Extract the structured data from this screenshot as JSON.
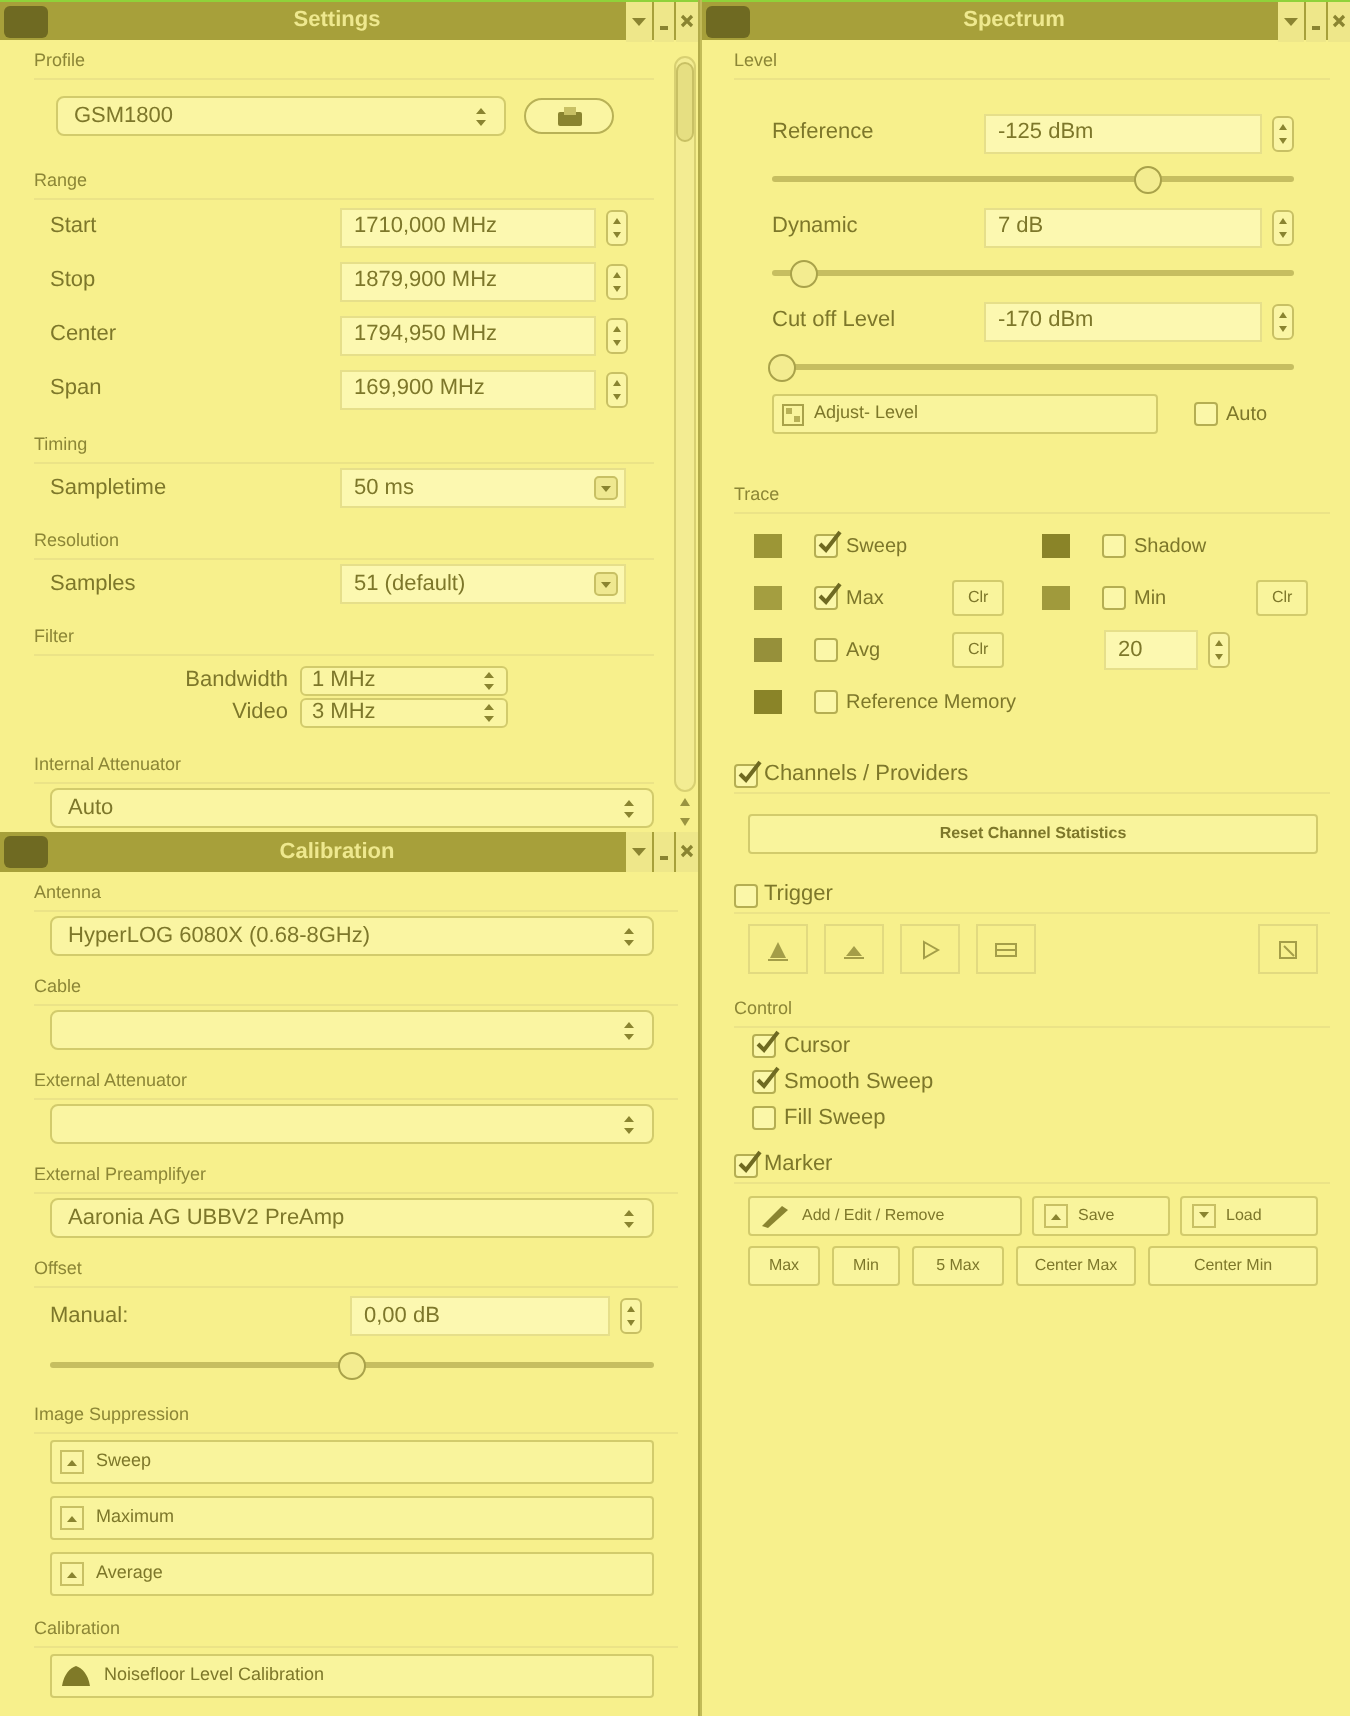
{
  "settings": {
    "title": "Settings",
    "sections": [
      {
        "label": "Profile",
        "items": [
          {
            "kind": "combo_button",
            "value": "GSM1800"
          }
        ]
      },
      {
        "label": "Range",
        "items": [
          {
            "kind": "spin",
            "name": "Start",
            "value": "1710,000 MHz"
          },
          {
            "kind": "spin",
            "name": "Stop",
            "value": "1879,900 MHz"
          },
          {
            "kind": "spin",
            "name": "Center",
            "value": "1794,950 MHz"
          },
          {
            "kind": "spin",
            "name": "Span",
            "value": "169,900 MHz"
          }
        ]
      },
      {
        "label": "Timing",
        "items": [
          {
            "kind": "dropdown",
            "name": "Sampletime",
            "value": "50 ms"
          }
        ]
      },
      {
        "label": "Resolution",
        "items": [
          {
            "kind": "dropdown",
            "name": "Samples",
            "value": "51 (default)"
          }
        ]
      },
      {
        "label": "Filter",
        "items": [
          {
            "kind": "small_combo",
            "name": "Bandwidth",
            "value": "1 MHz"
          },
          {
            "kind": "small_combo",
            "name": "Video",
            "value": "3 MHz"
          }
        ]
      },
      {
        "label": "Internal Attenuator",
        "items": [
          {
            "kind": "combo",
            "value": "Auto"
          }
        ]
      }
    ]
  },
  "calibration": {
    "title": "Calibration",
    "sections": [
      {
        "label": "Antenna",
        "items": [
          {
            "kind": "combo",
            "value": "HyperLOG 6080X (0.68-8GHz)"
          }
        ]
      },
      {
        "label": "Cable",
        "items": [
          {
            "kind": "combo"
          }
        ]
      },
      {
        "label": "External Attenuator",
        "items": [
          {
            "kind": "combo"
          }
        ]
      },
      {
        "label": "External Preamplifyer",
        "items": [
          {
            "kind": "combo",
            "value": "Aaronia AG UBBV2 PreAmp"
          }
        ]
      },
      {
        "label": "Offset",
        "items": [
          {
            "kind": "spin_slider",
            "name": "Manual:",
            "value": "0,00 dB",
            "level": 0.5
          }
        ]
      },
      {
        "label": "Image Suppression",
        "items": [
          {
            "kind": "button",
            "label": "Sweep"
          },
          {
            "kind": "button",
            "label": "Maximum"
          },
          {
            "kind": "button",
            "label": "Average"
          }
        ]
      },
      {
        "label": "Calibration",
        "items": [
          {
            "kind": "icon_button",
            "label": "Noisefloor Level Calibration"
          }
        ]
      }
    ]
  },
  "spectrum": {
    "title": "Spectrum",
    "level": {
      "label": "Level",
      "rows": [
        {
          "name": "Reference",
          "value": "-125 dBm",
          "level": 0.72
        },
        {
          "name": "Dynamic",
          "value": "7 dB",
          "level": 0.06
        },
        {
          "name": "Cut off Level",
          "value": "-170 dBm",
          "level": 0.02
        }
      ],
      "adjust_button": "Adjust- Level",
      "auto": {
        "label": "Auto",
        "checked": false
      }
    },
    "trace": {
      "label": "Trace",
      "rows": [
        [
          {
            "kind": "trace",
            "color": "#9c9636",
            "label": "Sweep",
            "checked": true
          },
          {
            "kind": "trace",
            "color": "#8a8428",
            "label": "Shadow",
            "checked": false
          }
        ],
        [
          {
            "kind": "trace",
            "color": "#a49e40",
            "label": "Max",
            "checked": true,
            "clear": "Clr"
          },
          {
            "kind": "trace",
            "color": "#a09a3c",
            "label": "Min",
            "checked": false,
            "clear": "Clr"
          }
        ],
        [
          {
            "kind": "trace",
            "color": "#96903a",
            "label": "Avg",
            "checked": false,
            "clear": "Clr"
          },
          {
            "kind": "spin",
            "value": "20"
          }
        ],
        [
          {
            "kind": "trace",
            "color": "#8a8428",
            "label": "Reference Memory",
            "checked": false
          }
        ]
      ]
    },
    "channels": {
      "label": "Channels / Providers",
      "checked": true,
      "button": "Reset Channel Statistics"
    },
    "trigger": {
      "label": "Trigger",
      "checked": false
    },
    "control": {
      "label": "Control",
      "options": [
        {
          "label": "Cursor",
          "checked": true
        },
        {
          "label": "Smooth Sweep",
          "checked": true
        },
        {
          "label": "Fill Sweep",
          "checked": false
        }
      ]
    },
    "marker": {
      "label": "Marker",
      "checked": true,
      "buttons": [
        "Add / Edit / Remove",
        "Save",
        "Load"
      ],
      "quick_buttons": [
        "Max",
        "Min",
        "5 Max",
        "Center Max",
        "Center Min"
      ]
    }
  }
}
